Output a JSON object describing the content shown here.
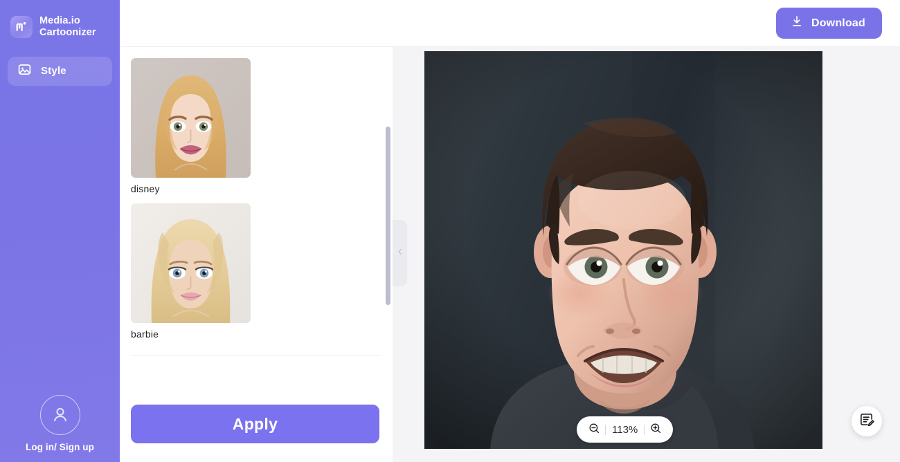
{
  "app": {
    "brand_name": "Media.io\nCartoonizer",
    "logo_icon": "media-io-m-logo"
  },
  "sidebar": {
    "items": [
      {
        "label": "Style",
        "icon": "image-icon",
        "active": true
      }
    ],
    "footer": {
      "label": "Log in/ Sign up",
      "icon": "user-avatar-icon"
    }
  },
  "topbar": {
    "download_label": "Download",
    "download_icon": "download-icon",
    "accent_color": "#7a73e8"
  },
  "style_panel": {
    "styles": [
      {
        "name": "disney",
        "selected": false
      },
      {
        "name": "barbie",
        "selected": false
      }
    ],
    "apply_label": "Apply",
    "apply_color": "#7a72ee"
  },
  "canvas": {
    "collapse_icon": "chevron-left-icon",
    "zoom": {
      "value": "113%",
      "zoom_out_icon": "zoom-out-icon",
      "zoom_in_icon": "zoom-in-icon"
    },
    "feedback_icon": "feedback-note-icon",
    "preview_alt": "cartoonized portrait of a man"
  }
}
